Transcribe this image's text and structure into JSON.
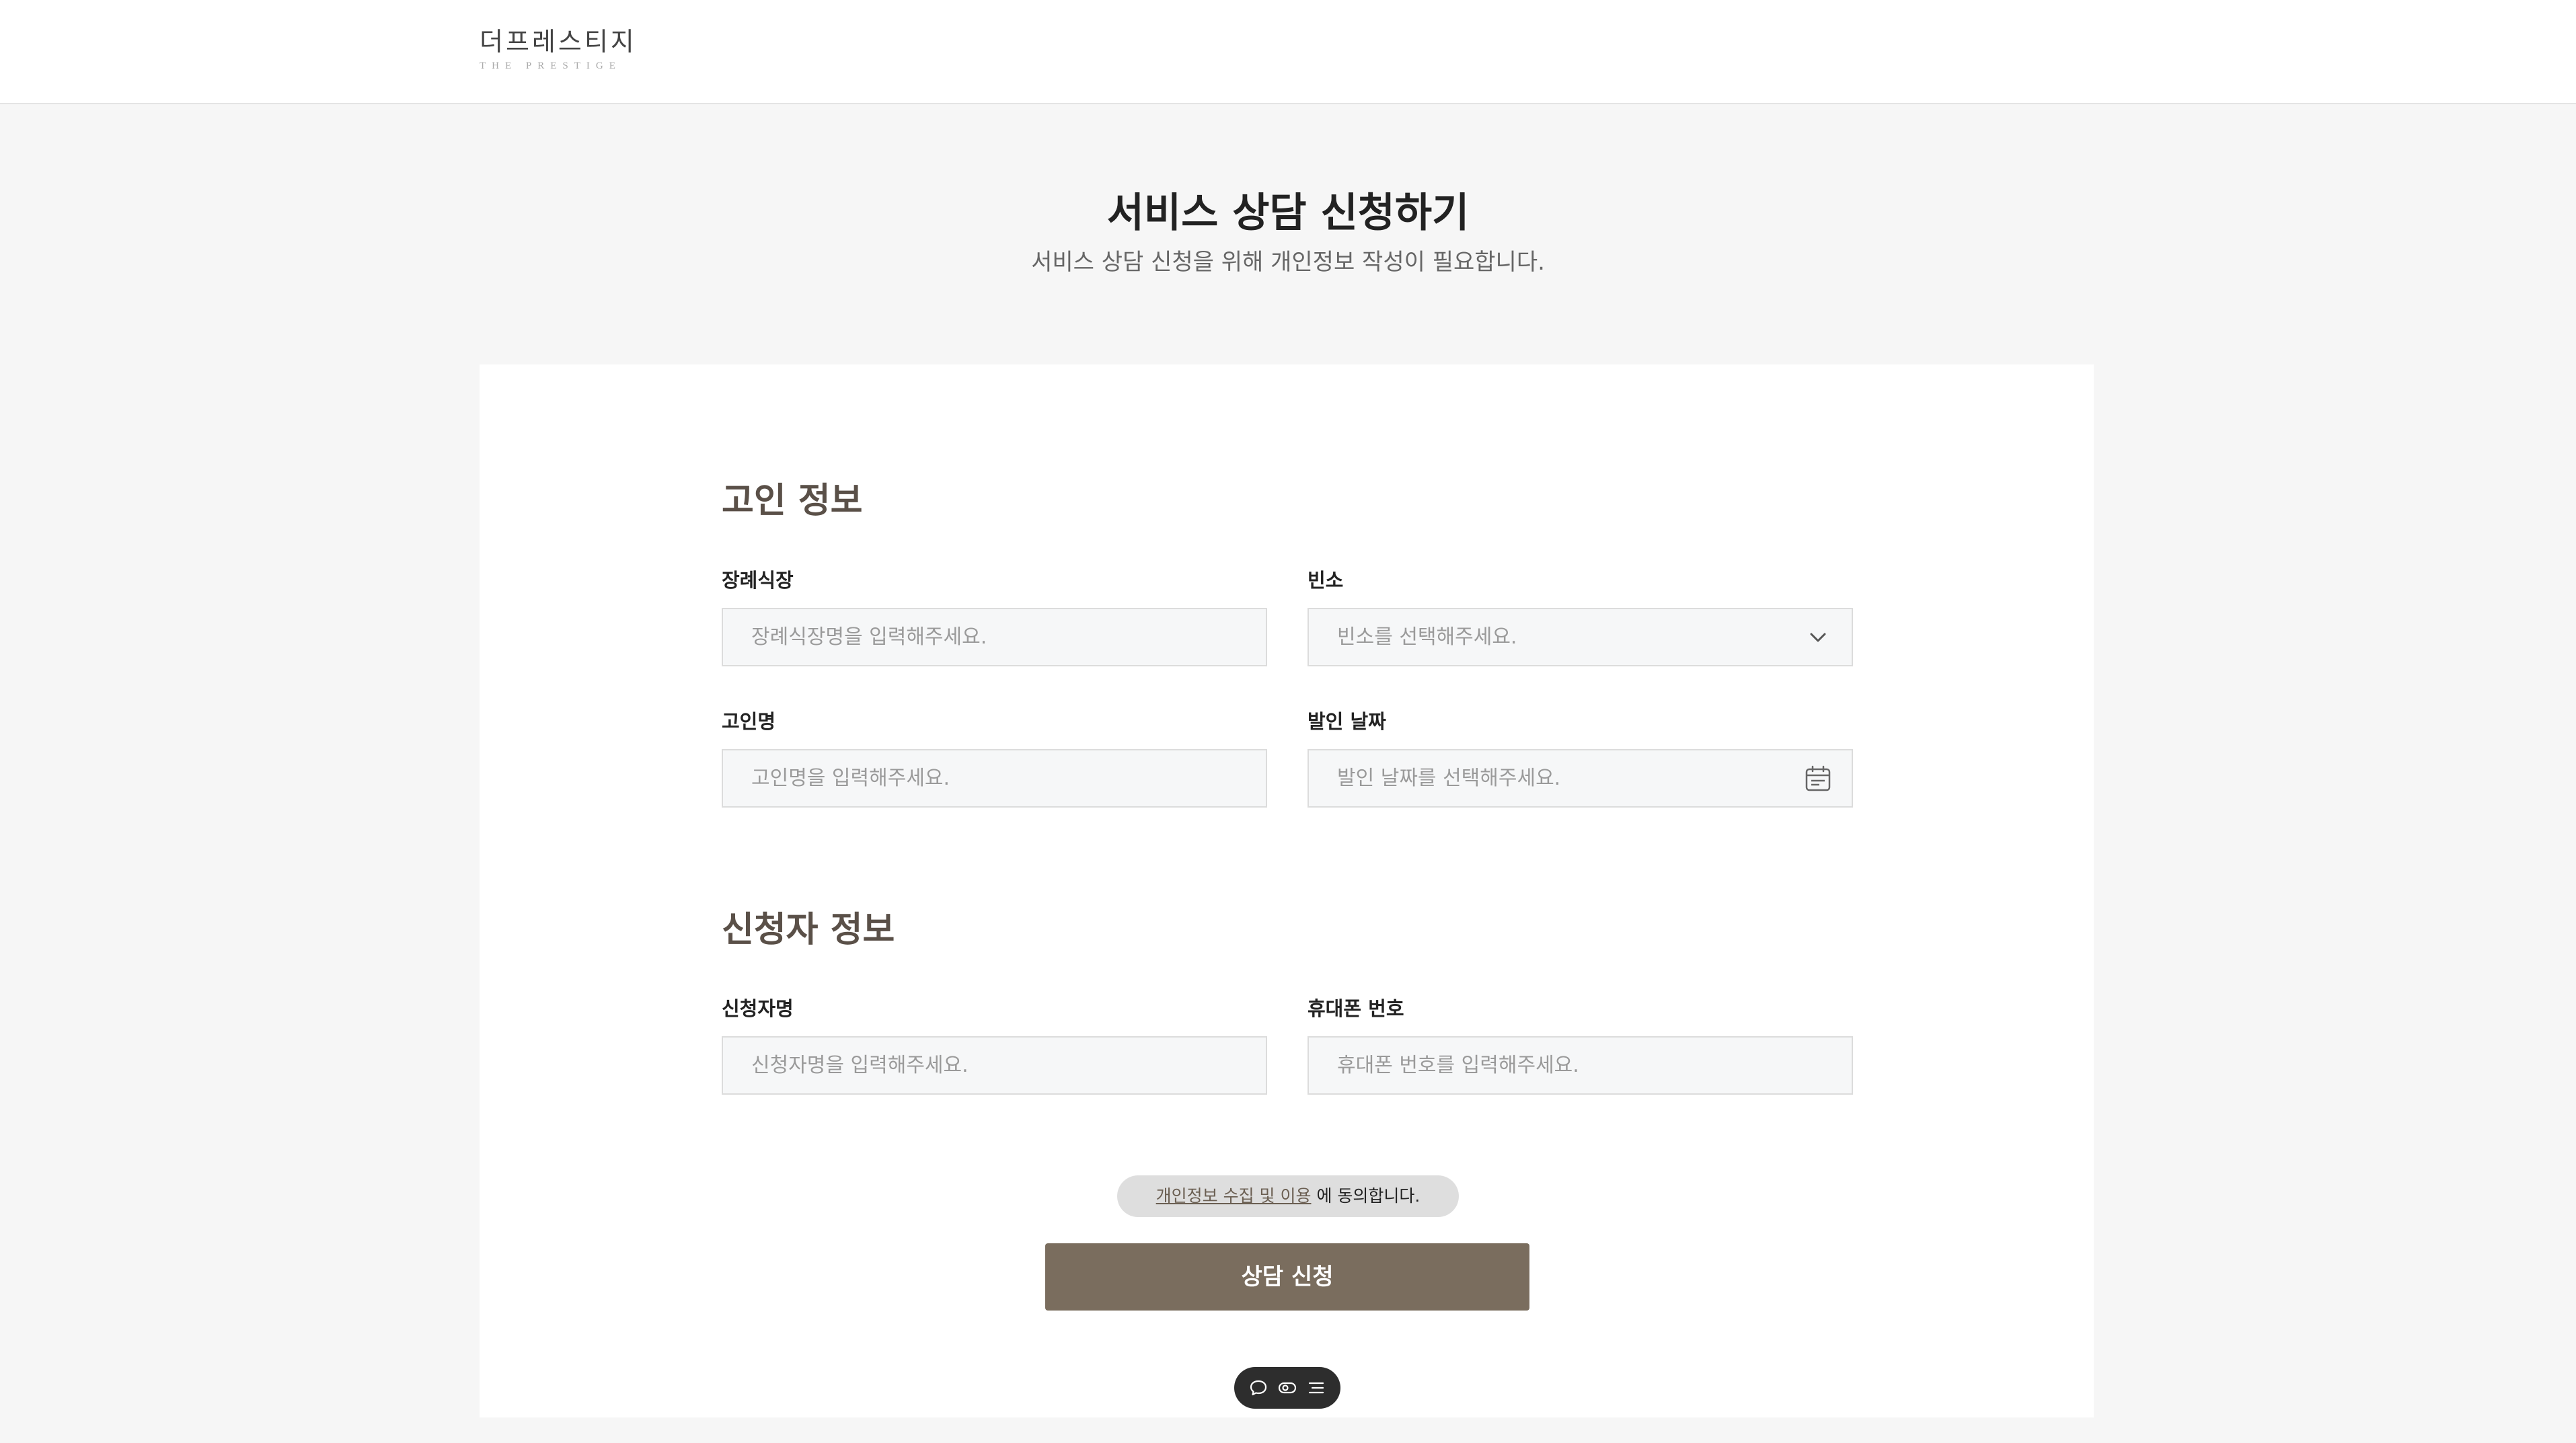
{
  "header": {
    "logo_korean": "더프레스티지",
    "logo_english": "THE PRESTIGE"
  },
  "page": {
    "title": "서비스 상담 신청하기",
    "subtitle": "서비스 상담 신청을 위해 개인정보 작성이 필요합니다."
  },
  "deceased_section": {
    "title": "고인 정보",
    "funeral_hall": {
      "label": "장례식장",
      "placeholder": "장례식장명을 입력해주세요."
    },
    "mortuary": {
      "label": "빈소",
      "placeholder": "빈소를 선택해주세요.",
      "icon": "chevron-down-icon"
    },
    "deceased_name": {
      "label": "고인명",
      "placeholder": "고인명을 입력해주세요."
    },
    "funeral_date": {
      "label": "발인 날짜",
      "placeholder": "발인 날짜를 선택해주세요.",
      "icon": "calendar-icon"
    }
  },
  "applicant_section": {
    "title": "신청자 정보",
    "applicant_name": {
      "label": "신청자명",
      "placeholder": "신청자명을 입력해주세요."
    },
    "phone": {
      "label": "휴대폰 번호",
      "placeholder": "휴대폰 번호를 입력해주세요."
    }
  },
  "consent": {
    "link_text": "개인정보 수집 및 이용",
    "suffix_text": " 에 동의합니다."
  },
  "submit": {
    "label": "상담 신청"
  },
  "floating_toolbar": {
    "icons": [
      "chat-bubble-icon",
      "toggle-icon",
      "menu-list-icon"
    ]
  },
  "colors": {
    "accent": "#7a6d5e",
    "section_title": "#5a5048",
    "background": "#f6f6f6",
    "toolbar": "#2d2d2d"
  }
}
